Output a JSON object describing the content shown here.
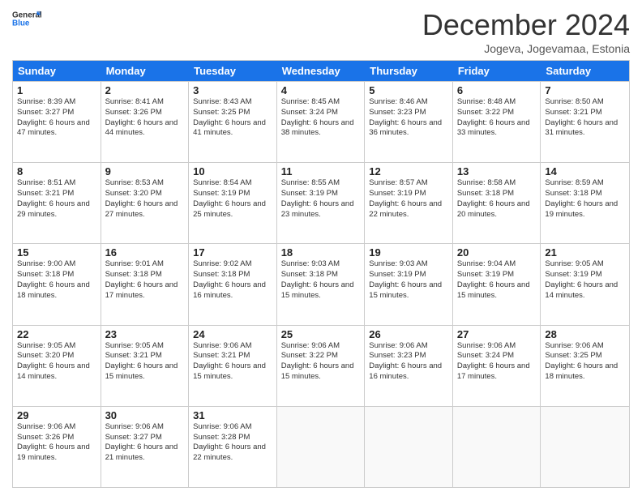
{
  "logo": {
    "line1": "General",
    "line2": "Blue"
  },
  "title": "December 2024",
  "subtitle": "Jogeva, Jogevamaa, Estonia",
  "days": [
    "Sunday",
    "Monday",
    "Tuesday",
    "Wednesday",
    "Thursday",
    "Friday",
    "Saturday"
  ],
  "weeks": [
    [
      {
        "num": "1",
        "sunrise": "8:39 AM",
        "sunset": "3:27 PM",
        "daylight": "6 hours and 47 minutes."
      },
      {
        "num": "2",
        "sunrise": "8:41 AM",
        "sunset": "3:26 PM",
        "daylight": "6 hours and 44 minutes."
      },
      {
        "num": "3",
        "sunrise": "8:43 AM",
        "sunset": "3:25 PM",
        "daylight": "6 hours and 41 minutes."
      },
      {
        "num": "4",
        "sunrise": "8:45 AM",
        "sunset": "3:24 PM",
        "daylight": "6 hours and 38 minutes."
      },
      {
        "num": "5",
        "sunrise": "8:46 AM",
        "sunset": "3:23 PM",
        "daylight": "6 hours and 36 minutes."
      },
      {
        "num": "6",
        "sunrise": "8:48 AM",
        "sunset": "3:22 PM",
        "daylight": "6 hours and 33 minutes."
      },
      {
        "num": "7",
        "sunrise": "8:50 AM",
        "sunset": "3:21 PM",
        "daylight": "6 hours and 31 minutes."
      }
    ],
    [
      {
        "num": "8",
        "sunrise": "8:51 AM",
        "sunset": "3:21 PM",
        "daylight": "6 hours and 29 minutes."
      },
      {
        "num": "9",
        "sunrise": "8:53 AM",
        "sunset": "3:20 PM",
        "daylight": "6 hours and 27 minutes."
      },
      {
        "num": "10",
        "sunrise": "8:54 AM",
        "sunset": "3:19 PM",
        "daylight": "6 hours and 25 minutes."
      },
      {
        "num": "11",
        "sunrise": "8:55 AM",
        "sunset": "3:19 PM",
        "daylight": "6 hours and 23 minutes."
      },
      {
        "num": "12",
        "sunrise": "8:57 AM",
        "sunset": "3:19 PM",
        "daylight": "6 hours and 22 minutes."
      },
      {
        "num": "13",
        "sunrise": "8:58 AM",
        "sunset": "3:18 PM",
        "daylight": "6 hours and 20 minutes."
      },
      {
        "num": "14",
        "sunrise": "8:59 AM",
        "sunset": "3:18 PM",
        "daylight": "6 hours and 19 minutes."
      }
    ],
    [
      {
        "num": "15",
        "sunrise": "9:00 AM",
        "sunset": "3:18 PM",
        "daylight": "6 hours and 18 minutes."
      },
      {
        "num": "16",
        "sunrise": "9:01 AM",
        "sunset": "3:18 PM",
        "daylight": "6 hours and 17 minutes."
      },
      {
        "num": "17",
        "sunrise": "9:02 AM",
        "sunset": "3:18 PM",
        "daylight": "6 hours and 16 minutes."
      },
      {
        "num": "18",
        "sunrise": "9:03 AM",
        "sunset": "3:18 PM",
        "daylight": "6 hours and 15 minutes."
      },
      {
        "num": "19",
        "sunrise": "9:03 AM",
        "sunset": "3:19 PM",
        "daylight": "6 hours and 15 minutes."
      },
      {
        "num": "20",
        "sunrise": "9:04 AM",
        "sunset": "3:19 PM",
        "daylight": "6 hours and 15 minutes."
      },
      {
        "num": "21",
        "sunrise": "9:05 AM",
        "sunset": "3:19 PM",
        "daylight": "6 hours and 14 minutes."
      }
    ],
    [
      {
        "num": "22",
        "sunrise": "9:05 AM",
        "sunset": "3:20 PM",
        "daylight": "6 hours and 14 minutes."
      },
      {
        "num": "23",
        "sunrise": "9:05 AM",
        "sunset": "3:21 PM",
        "daylight": "6 hours and 15 minutes."
      },
      {
        "num": "24",
        "sunrise": "9:06 AM",
        "sunset": "3:21 PM",
        "daylight": "6 hours and 15 minutes."
      },
      {
        "num": "25",
        "sunrise": "9:06 AM",
        "sunset": "3:22 PM",
        "daylight": "6 hours and 15 minutes."
      },
      {
        "num": "26",
        "sunrise": "9:06 AM",
        "sunset": "3:23 PM",
        "daylight": "6 hours and 16 minutes."
      },
      {
        "num": "27",
        "sunrise": "9:06 AM",
        "sunset": "3:24 PM",
        "daylight": "6 hours and 17 minutes."
      },
      {
        "num": "28",
        "sunrise": "9:06 AM",
        "sunset": "3:25 PM",
        "daylight": "6 hours and 18 minutes."
      }
    ],
    [
      {
        "num": "29",
        "sunrise": "9:06 AM",
        "sunset": "3:26 PM",
        "daylight": "6 hours and 19 minutes."
      },
      {
        "num": "30",
        "sunrise": "9:06 AM",
        "sunset": "3:27 PM",
        "daylight": "6 hours and 21 minutes."
      },
      {
        "num": "31",
        "sunrise": "9:06 AM",
        "sunset": "3:28 PM",
        "daylight": "6 hours and 22 minutes."
      },
      null,
      null,
      null,
      null
    ]
  ],
  "labels": {
    "sunrise": "Sunrise:",
    "sunset": "Sunset:",
    "daylight": "Daylight:"
  }
}
